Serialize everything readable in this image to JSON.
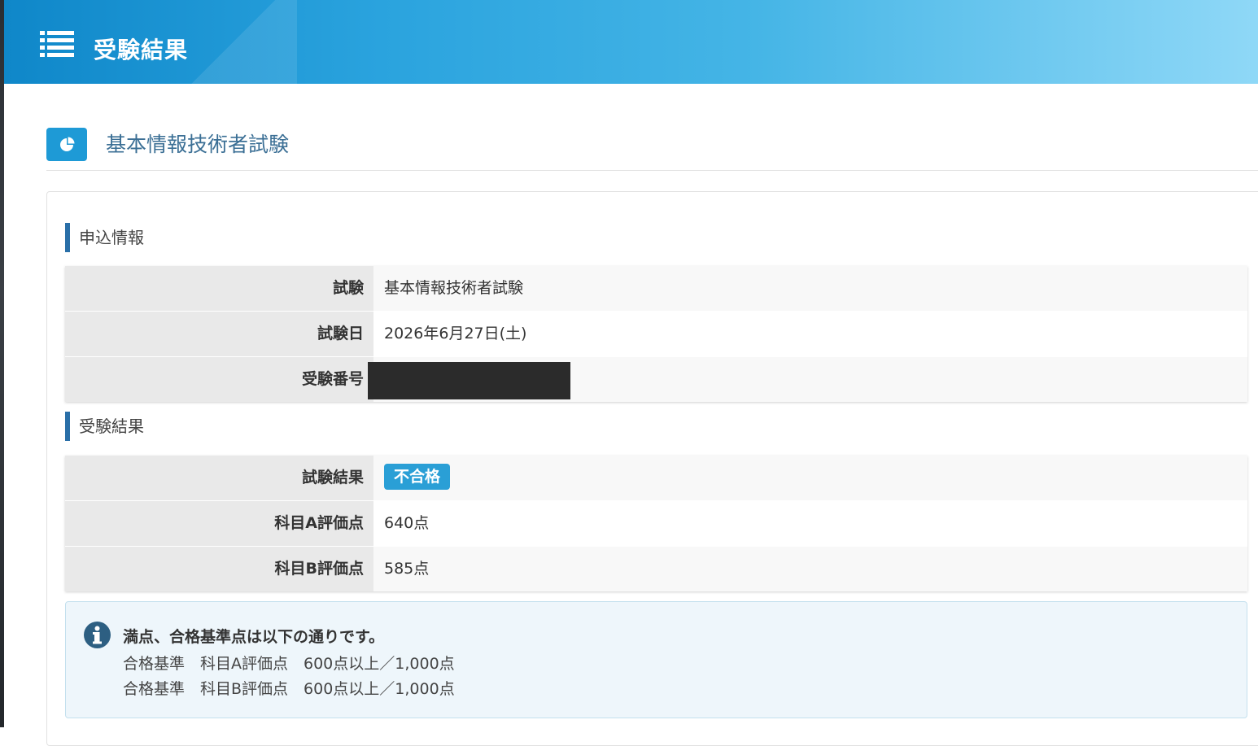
{
  "header": {
    "title": "受験結果",
    "menu_icon": "list-icon"
  },
  "exam": {
    "title": "基本情報技術者試験",
    "title_icon": "pie-chart-icon"
  },
  "application_info": {
    "heading": "申込情報",
    "rows": [
      {
        "label": "試験",
        "value": "基本情報技術者試験"
      },
      {
        "label": "試験日",
        "value": "2026年6月27日(土)"
      },
      {
        "label": "受験番号",
        "value": ""
      }
    ]
  },
  "results": {
    "heading": "受験結果",
    "rows": [
      {
        "label": "試験結果",
        "value": "不合格"
      },
      {
        "label": "科目A評価点",
        "value": "640点"
      },
      {
        "label": "科目B評価点",
        "value": "585点"
      }
    ]
  },
  "notice": {
    "icon": "info-icon",
    "lead": "満点、合格基準点は以下の通りです。",
    "lines": [
      "合格基準　科目A評価点　600点以上／1,000点",
      "合格基準　科目B評価点　600点以上／1,000点"
    ]
  },
  "colors": {
    "header_start": "#0f87c9",
    "header_end": "#8fd8f7",
    "badge": "#2a9fd6",
    "accent_bar": "#2a6fa8",
    "exam_title": "#3b6f95"
  }
}
